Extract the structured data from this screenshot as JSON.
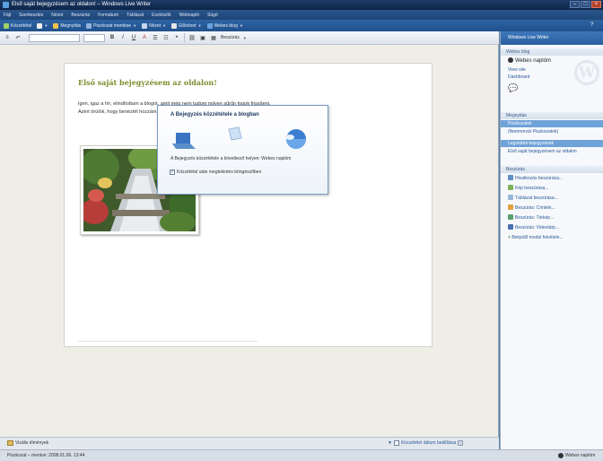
{
  "window": {
    "title": "Első saját bejegyzésem az oldalon! – Windows Live Writer"
  },
  "menu": [
    "Fájl",
    "Szerkesztés",
    "Nézet",
    "Beszúrás",
    "Formátum",
    "Táblázat",
    "Eszközök",
    "Webnapló",
    "Súgó"
  ],
  "toolbar": {
    "new": "Közzététel",
    "save": "Megnyitás",
    "draft": "Piszkozat mentése",
    "view": "Nézet",
    "preview": "Előnézet",
    "blog": "Webes blog"
  },
  "format_toolbar": {
    "bold": "B",
    "italic": "I",
    "underline": "U",
    "insert": "Beszúrás"
  },
  "post": {
    "title": "Első saját bejegyzésem az oldalon!",
    "body": "Igen, igaz a hír, elindítottam a blogot, amit még nem tudom milyen sűrűn fogok frissíteni. Azért örülök, hogy benéztél hozzám."
  },
  "publish_dialog": {
    "title": "A Bejegyzés közzététele a blogban",
    "target": "A Bejegyzés közzététele a következő helyen: Webes naplóm",
    "checkbox": "Közzététel után megtekintés böngészőben"
  },
  "sidebar": {
    "header": "Windows Live Writer",
    "blog_section": "Webes blog",
    "blog_name": "Webes naplóm",
    "links": [
      "View site",
      "Dashboard"
    ],
    "open_section": "Megnyitás",
    "open_items": [
      "Piszkozatok",
      "(Nemrenvár Piszkozatok)"
    ],
    "recent_section": "Legutóbbi bejegyzések",
    "recent_item": "Első saját bejegyzésem az oldalon",
    "insert_section": "Beszúrás",
    "insert_items": [
      "Hivatkozás beszúrása...",
      "Kép beszúrása...",
      "Táblázat beszúrása...",
      "Beszúrás: Címkék...",
      "Beszúrás: Térkép...",
      "Beszúrás: Videotárp..."
    ],
    "add_plugin": "Bekpülő modul felvétele..."
  },
  "bottom": {
    "view_mode": "Vizális élmények",
    "date_override": "Közzététel dátum beállítása"
  },
  "status": {
    "text": "Piszkozat – mentve: 2008.01.06. 13:44",
    "blog": "Webes naplóm"
  }
}
